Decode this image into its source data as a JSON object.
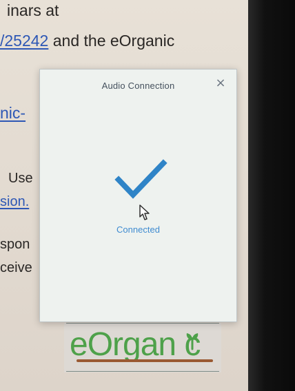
{
  "document": {
    "line1": "inars at",
    "line2_link": "/25242",
    "line2_rest": " and the eOrganic",
    "line3_link": "nic-",
    "line4": "Use",
    "line5_link": "sion.",
    "line6": "spon",
    "line7": "ceive"
  },
  "dialog": {
    "title": "Audio Connection",
    "close_label": "×",
    "status": "Connected"
  },
  "logo": {
    "text": "eOrgan c"
  },
  "colors": {
    "accent": "#3f8bd0",
    "check": "#2f84c7",
    "logo_green": "#4ea14a",
    "logo_soil": "#9a5a33"
  },
  "icons": {
    "check": "check-icon",
    "close": "close-icon",
    "cursor": "mouse-cursor-icon",
    "sprout": "sprout-icon"
  }
}
